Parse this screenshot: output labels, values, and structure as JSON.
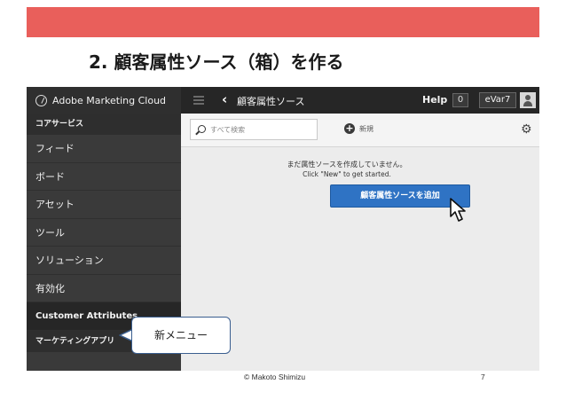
{
  "slide": {
    "title": "2. 顧客属性ソース（箱）を作る",
    "footer_copyright": "© Makoto Shimizu",
    "page_number": "7",
    "accent_color": "#e95f5b"
  },
  "topbar": {
    "brand": "Adobe Marketing Cloud",
    "brand_icon": "adobe-marketing-cloud-logo-icon",
    "page_name": "顧客属性ソース",
    "help_label": "Help",
    "notification_count": "0",
    "org_name": "eVar7"
  },
  "sidebar": {
    "header": "コアサービス",
    "items": [
      {
        "label": "フィード"
      },
      {
        "label": "ボード"
      },
      {
        "label": "アセット"
      },
      {
        "label": "ツール"
      },
      {
        "label": "ソリューション"
      },
      {
        "label": "有効化"
      },
      {
        "label": "Customer Attributes"
      }
    ],
    "footer": "マーケティングアプリ"
  },
  "toolbar": {
    "search_placeholder": "すべて検索",
    "new_label": "新規"
  },
  "content": {
    "empty_message": "まだ属性ソースを作成していません。",
    "empty_sub": "Click \"New\" to get started.",
    "add_button_label": "顧客属性ソースを追加",
    "button_color": "#2f73c4"
  },
  "callout": {
    "label": "新メニュー"
  }
}
